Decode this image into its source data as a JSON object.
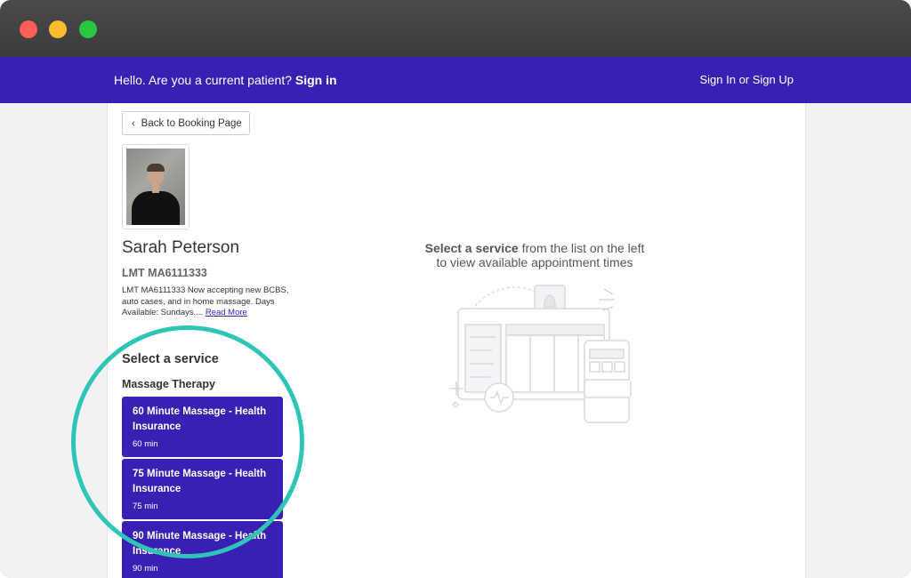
{
  "window": {
    "controls": [
      "close",
      "minimize",
      "maximize"
    ]
  },
  "navbar": {
    "greeting": "Hello. Are you a current patient?",
    "sign_in": "Sign in",
    "sign_up": "Sign In or Sign Up"
  },
  "back_button": {
    "label": "Back to Booking Page",
    "icon": "chevron-left-icon"
  },
  "provider": {
    "name": "Sarah Peterson",
    "license": "LMT MA6111333",
    "bio": "LMT MA6111333 Now accepting new BCBS, auto cases, and in home massage. Days Available: Sundays,...",
    "read_more": "Read More"
  },
  "services": {
    "title": "Select a service",
    "category": "Massage Therapy",
    "items": [
      {
        "name": "60 Minute Massage - Health Insurance",
        "duration": "60 min"
      },
      {
        "name": "75 Minute Massage - Health Insurance",
        "duration": "75 min"
      },
      {
        "name": "90 Minute Massage - Health Insurance",
        "duration": "90 min"
      }
    ]
  },
  "empty_state": {
    "bold": "Select a service",
    "rest_line1": "from the list on the left",
    "line2": "to view available appointment times"
  },
  "colors": {
    "brand": "#3a1fb5",
    "highlight": "#2ec4b6"
  }
}
